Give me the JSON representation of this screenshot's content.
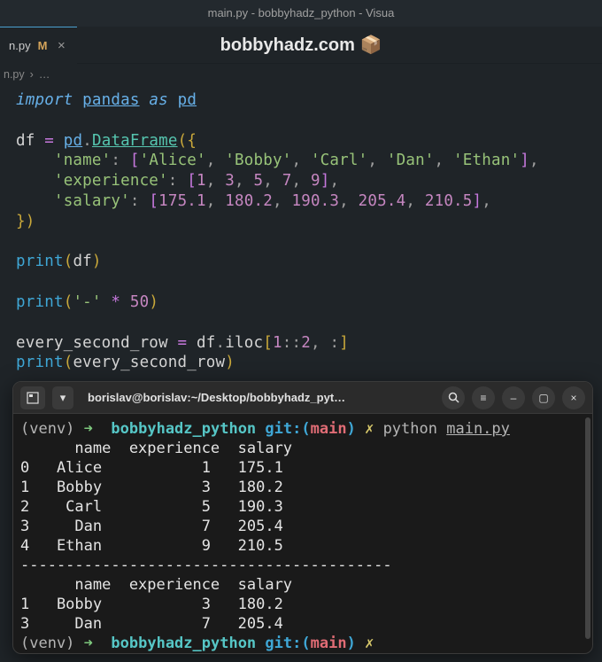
{
  "window": {
    "title": "main.py - bobbyhadz_python - Visua",
    "brand": "bobbyhadz.com",
    "brand_icon": "📦"
  },
  "tab": {
    "filename": "n.py",
    "modified_indicator": "M",
    "close_glyph": "×"
  },
  "breadcrumb": {
    "file": "n.py",
    "sep": "›",
    "more": "…"
  },
  "code": {
    "l1_import": "import",
    "l1_pandas": "pandas",
    "l1_as": "as",
    "l1_pd": "pd",
    "l3_df": "df",
    "l3_eq": "=",
    "l3_pd": "pd",
    "l3_dot": ".",
    "l3_class": "DataFrame",
    "k_name": "'name'",
    "v_name": "['Alice', 'Bobby', 'Carl', 'Dan', 'Ethan']",
    "k_exp": "'experience'",
    "v_exp_nums": "[1, 3, 5, 7, 9]",
    "k_sal": "'salary'",
    "v_sal_nums": "[175.1, 180.2, 190.3, 205.4, 210.5]",
    "print": "print",
    "dfvar": "df",
    "dash_lit": "'-'",
    "star": "*",
    "fifty": "50",
    "esr": "every_second_row",
    "iloc": "iloc",
    "one": "1",
    "two": "2",
    "colon": ":"
  },
  "terminal": {
    "title": "borislav@borislav:~/Desktop/bobbyhadz_pyt…",
    "icons": {
      "newtab": "➕",
      "dropdown": "▾",
      "search": "🔍",
      "menu": "≡",
      "min": "–",
      "max": "▢",
      "close": "×"
    },
    "prompt": {
      "venv": "(venv)",
      "arrow": "➜",
      "dir": "bobbyhadz_python",
      "git": "git:(",
      "branch": "main",
      "gitclose": ")",
      "dirty": "✗",
      "cmd": "python",
      "arg": "main.py"
    },
    "output_lines": [
      "      name  experience  salary",
      "0   Alice           1   175.1",
      "1   Bobby           3   180.2",
      "2    Carl           5   190.3",
      "3     Dan           7   205.4",
      "4   Ethan           9   210.5",
      "-----------------------------------------",
      "      name  experience  salary",
      "1   Bobby           3   180.2",
      "3     Dan           7   205.4"
    ]
  },
  "chart_data": {
    "type": "table",
    "title": "DataFrame output",
    "full": {
      "columns": [
        "name",
        "experience",
        "salary"
      ],
      "index": [
        0,
        1,
        2,
        3,
        4
      ],
      "rows": [
        [
          "Alice",
          1,
          175.1
        ],
        [
          "Bobby",
          3,
          180.2
        ],
        [
          "Carl",
          5,
          190.3
        ],
        [
          "Dan",
          7,
          205.4
        ],
        [
          "Ethan",
          9,
          210.5
        ]
      ]
    },
    "every_second_row": {
      "columns": [
        "name",
        "experience",
        "salary"
      ],
      "index": [
        1,
        3
      ],
      "rows": [
        [
          "Bobby",
          3,
          180.2
        ],
        [
          "Dan",
          7,
          205.4
        ]
      ]
    }
  }
}
